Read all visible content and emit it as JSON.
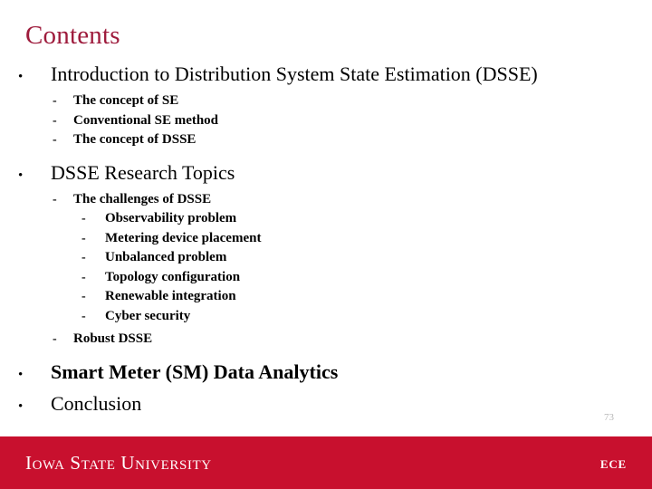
{
  "slide": {
    "title": "Contents",
    "title_color": "#9e1b3c",
    "page_number": "73"
  },
  "markers": {
    "level1": "•",
    "level2": "-",
    "level3": "-"
  },
  "outline": [
    {
      "level": 1,
      "text": "Introduction to Distribution System State Estimation (DSSE)",
      "bold": false
    },
    {
      "level": 2,
      "text": "The concept of SE"
    },
    {
      "level": 2,
      "text": "Conventional SE method"
    },
    {
      "level": 2,
      "text": "The concept of DSSE"
    },
    {
      "level": 1,
      "text": "DSSE Research Topics",
      "bold": false
    },
    {
      "level": 2,
      "text": "The challenges of DSSE"
    },
    {
      "level": 3,
      "text": "Observability problem"
    },
    {
      "level": 3,
      "text": "Metering device placement"
    },
    {
      "level": 3,
      "text": "Unbalanced problem"
    },
    {
      "level": 3,
      "text": "Topology configuration"
    },
    {
      "level": 3,
      "text": "Renewable integration"
    },
    {
      "level": 3,
      "text": "Cyber security"
    },
    {
      "level": 2,
      "text": "Robust DSSE"
    },
    {
      "level": 1,
      "text": "Smart Meter (SM) Data Analytics",
      "bold": true
    },
    {
      "level": 1,
      "text": "Conclusion",
      "bold": false
    }
  ],
  "footer": {
    "university": "Iowa State University",
    "department": "ECE",
    "band_color": "#c8102e"
  }
}
